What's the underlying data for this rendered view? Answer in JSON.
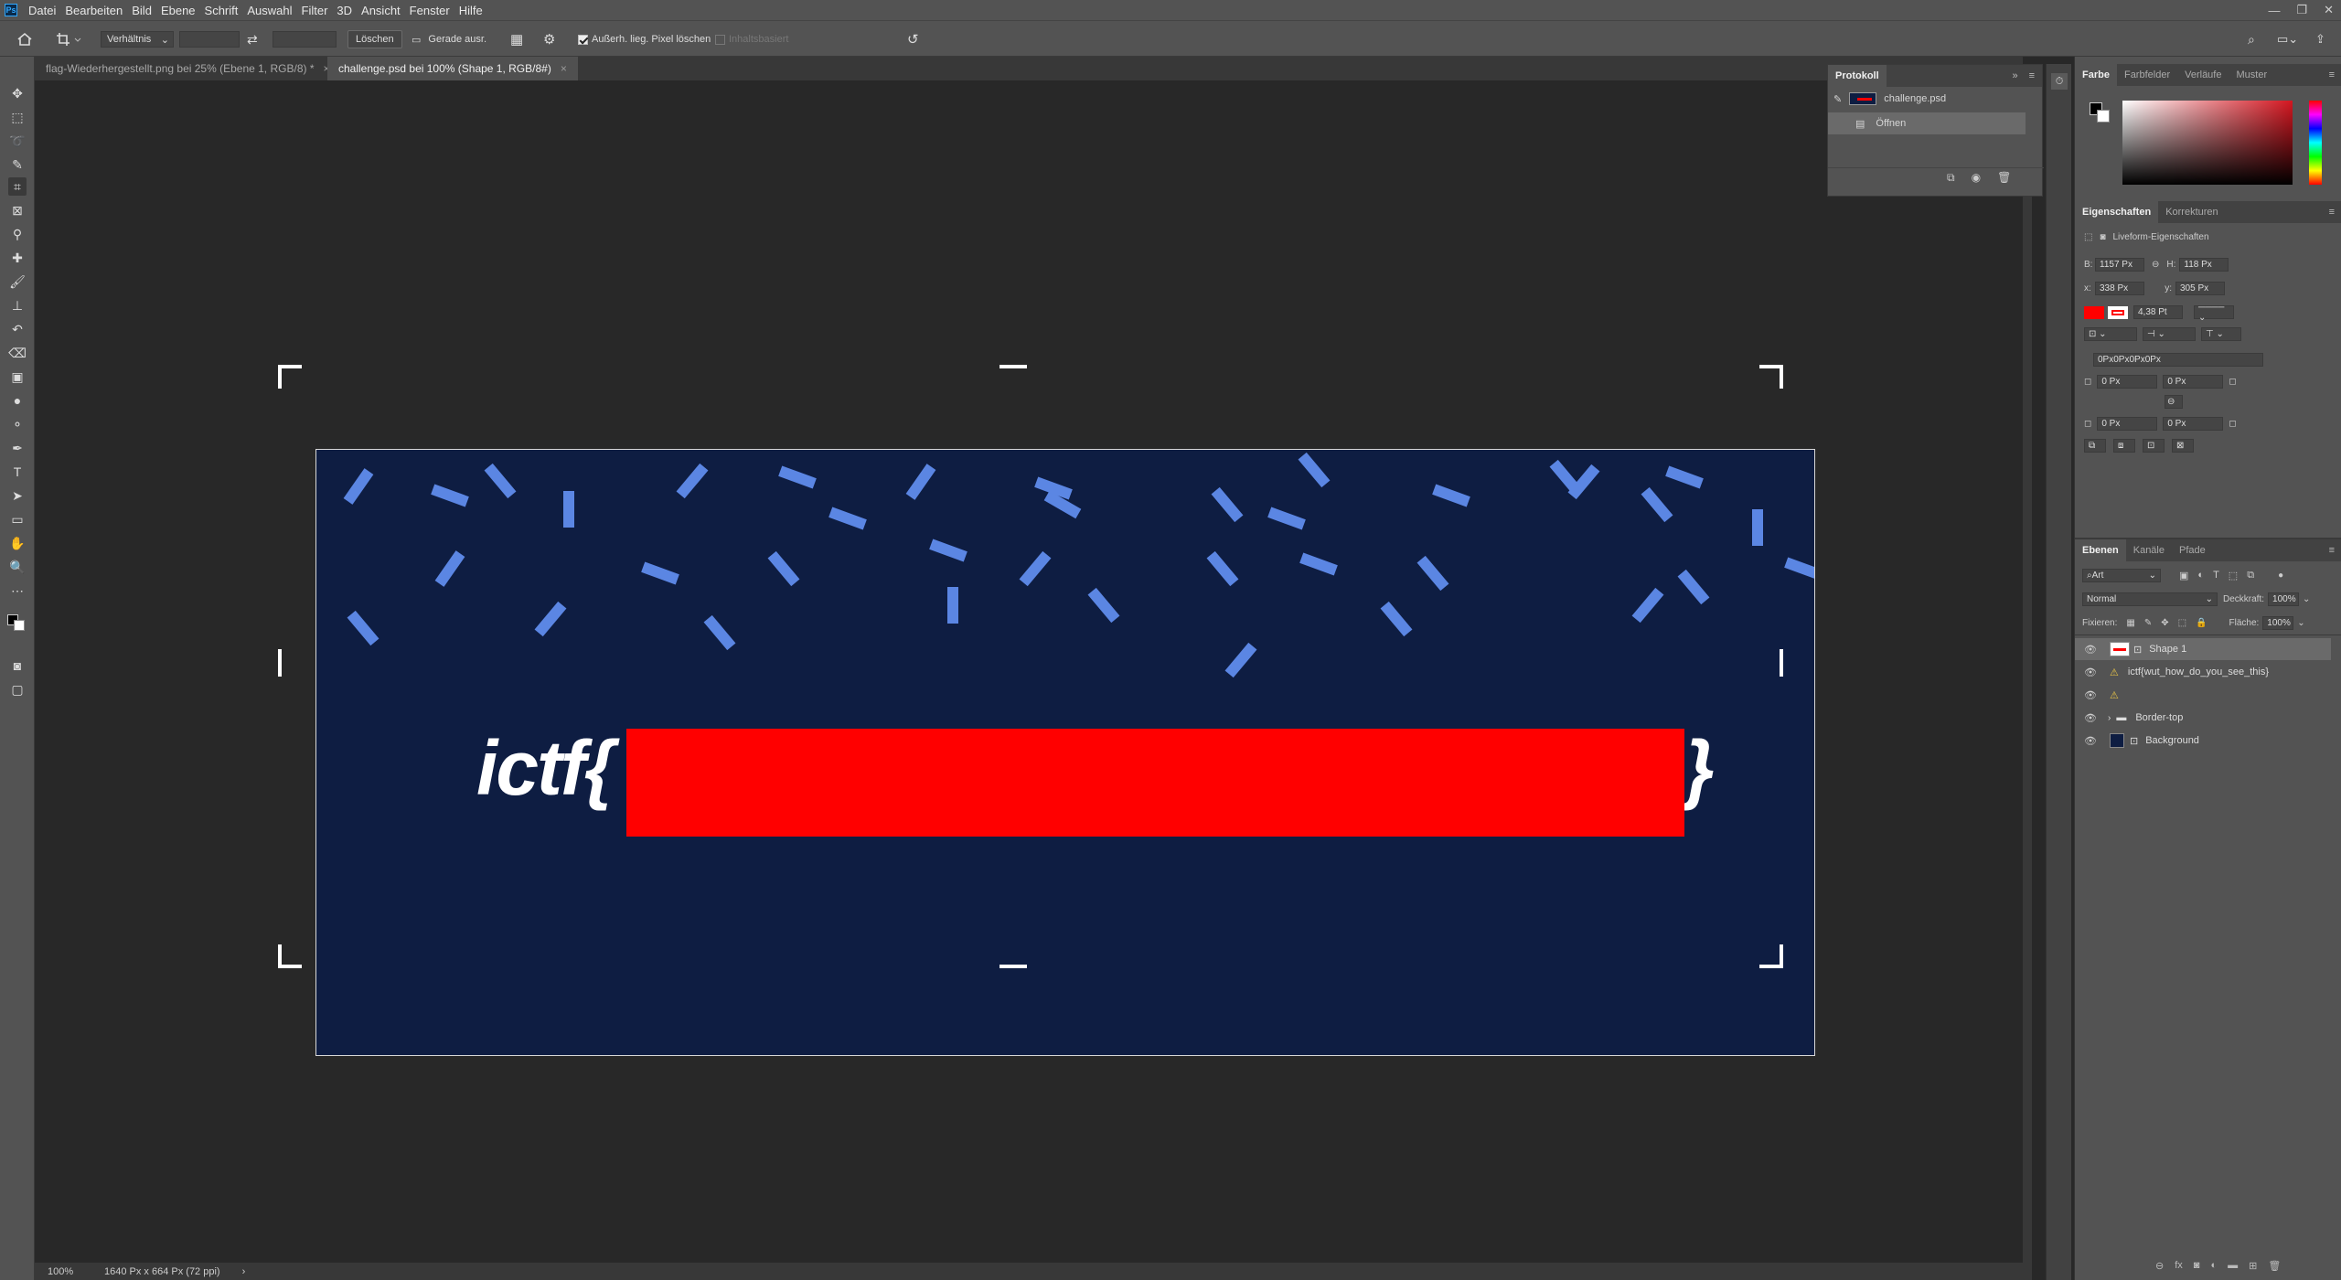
{
  "app": {
    "logo": "Ps"
  },
  "menu": [
    "Datei",
    "Bearbeiten",
    "Bild",
    "Ebene",
    "Schrift",
    "Auswahl",
    "Filter",
    "3D",
    "Ansicht",
    "Fenster",
    "Hilfe"
  ],
  "options": {
    "ratio": "Verhältnis",
    "clear": "Löschen",
    "straighten": "Gerade ausr.",
    "delete_cropped": "Außerh. lieg. Pixel löschen",
    "content_aware": "Inhaltsbasiert"
  },
  "tabs": [
    {
      "label": "flag-Wiederhergestellt.png bei 25% (Ebene 1, RGB/8) *"
    },
    {
      "label": "challenge.psd bei 100% (Shape 1, RGB/8#)"
    }
  ],
  "canvas": {
    "flag_text": "ictf{",
    "flag_tail": "}",
    "colors": {
      "background": "#0e1d42",
      "confetti": "#5b86e3",
      "shape": "#ff0000"
    }
  },
  "status": {
    "zoom": "100%",
    "doc_size": "1640 Px x 664 Px (72 ppi)"
  },
  "protokoll": {
    "title": "Protokoll",
    "snapshot": "challenge.psd",
    "step": "Öffnen"
  },
  "color_panel": {
    "tabs": [
      "Farbe",
      "Farbfelder",
      "Verläufe",
      "Muster"
    ]
  },
  "properties": {
    "tabs": [
      "Eigenschaften",
      "Korrekturen"
    ],
    "subtitle": "Liveform-Eigenschaften",
    "w_label": "B:",
    "w": "1157 Px",
    "h_label": "H:",
    "h": "118 Px",
    "x_label": "x:",
    "x": "338 Px",
    "y_label": "y:",
    "y": "305 Px",
    "stroke": "4,38 Pt",
    "radii": "0Px0Px0Px0Px",
    "r1": "0 Px",
    "r2": "0 Px",
    "r3": "0 Px",
    "r4": "0 Px"
  },
  "layers_panel": {
    "tabs": [
      "Ebenen",
      "Kanäle",
      "Pfade"
    ],
    "filter": "Art",
    "blend": "Normal",
    "opacity_label": "Deckkraft:",
    "opacity": "100%",
    "lock_label": "Fixieren:",
    "fill_label": "Fläche:",
    "fill": "100%",
    "layers": [
      {
        "name": "Shape 1"
      },
      {
        "name": "ictf{wut_how_do_you_see_this}"
      },
      {
        "name": ""
      },
      {
        "name": "Border-top"
      },
      {
        "name": "Background"
      }
    ]
  }
}
